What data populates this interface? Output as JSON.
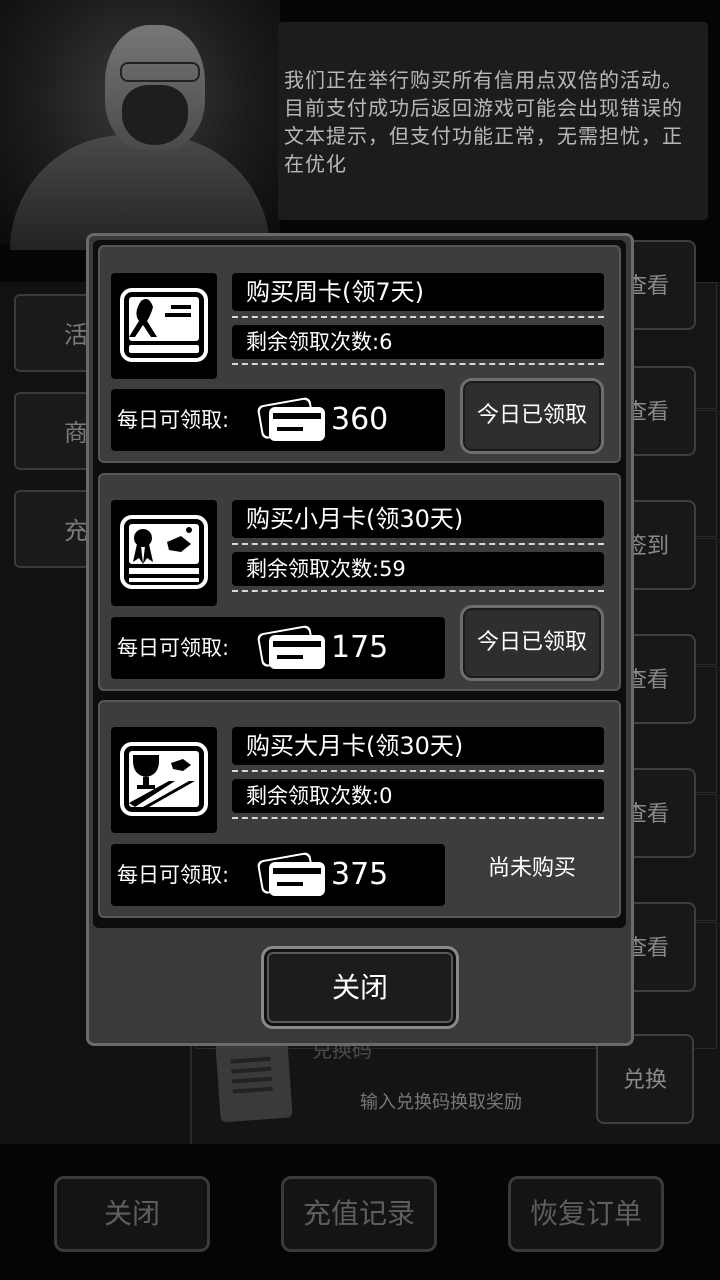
{
  "background": {
    "notice_text": "我们正在举行购买所有信用点双倍的活动。目前支付成功后返回游戏可能会出现错误的文本提示，但支付功能正常，无需担忧，正在优化",
    "left_tabs": [
      "活",
      "商",
      "充"
    ],
    "right_buttons": [
      "查看",
      "查看",
      "签到",
      "查看",
      "查看",
      "查看"
    ],
    "redeem": {
      "title": "兑换码",
      "hint": "输入兑换码换取奖励",
      "button": "兑换"
    },
    "bottom_buttons": {
      "close": "关闭",
      "history": "充值记录",
      "restore": "恢复订单"
    }
  },
  "modal": {
    "cards": [
      {
        "title": "购买周卡(领7天)",
        "remaining": "剩余领取次数:6",
        "daily_label": "每日可领取:",
        "daily_value": "360",
        "action": "今日已领取",
        "icon": "ribbon-card-icon"
      },
      {
        "title": "购买小月卡(领30天)",
        "remaining": "剩余领取次数:59",
        "daily_label": "每日可领取:",
        "daily_value": "175",
        "action": "今日已领取",
        "icon": "rosette-card-icon"
      },
      {
        "title": "购买大月卡(领30天)",
        "remaining": "剩余领取次数:0",
        "daily_label": "每日可领取:",
        "daily_value": "375",
        "action": "尚未购买",
        "icon": "trophy-card-icon"
      }
    ],
    "close_label": "关闭"
  }
}
